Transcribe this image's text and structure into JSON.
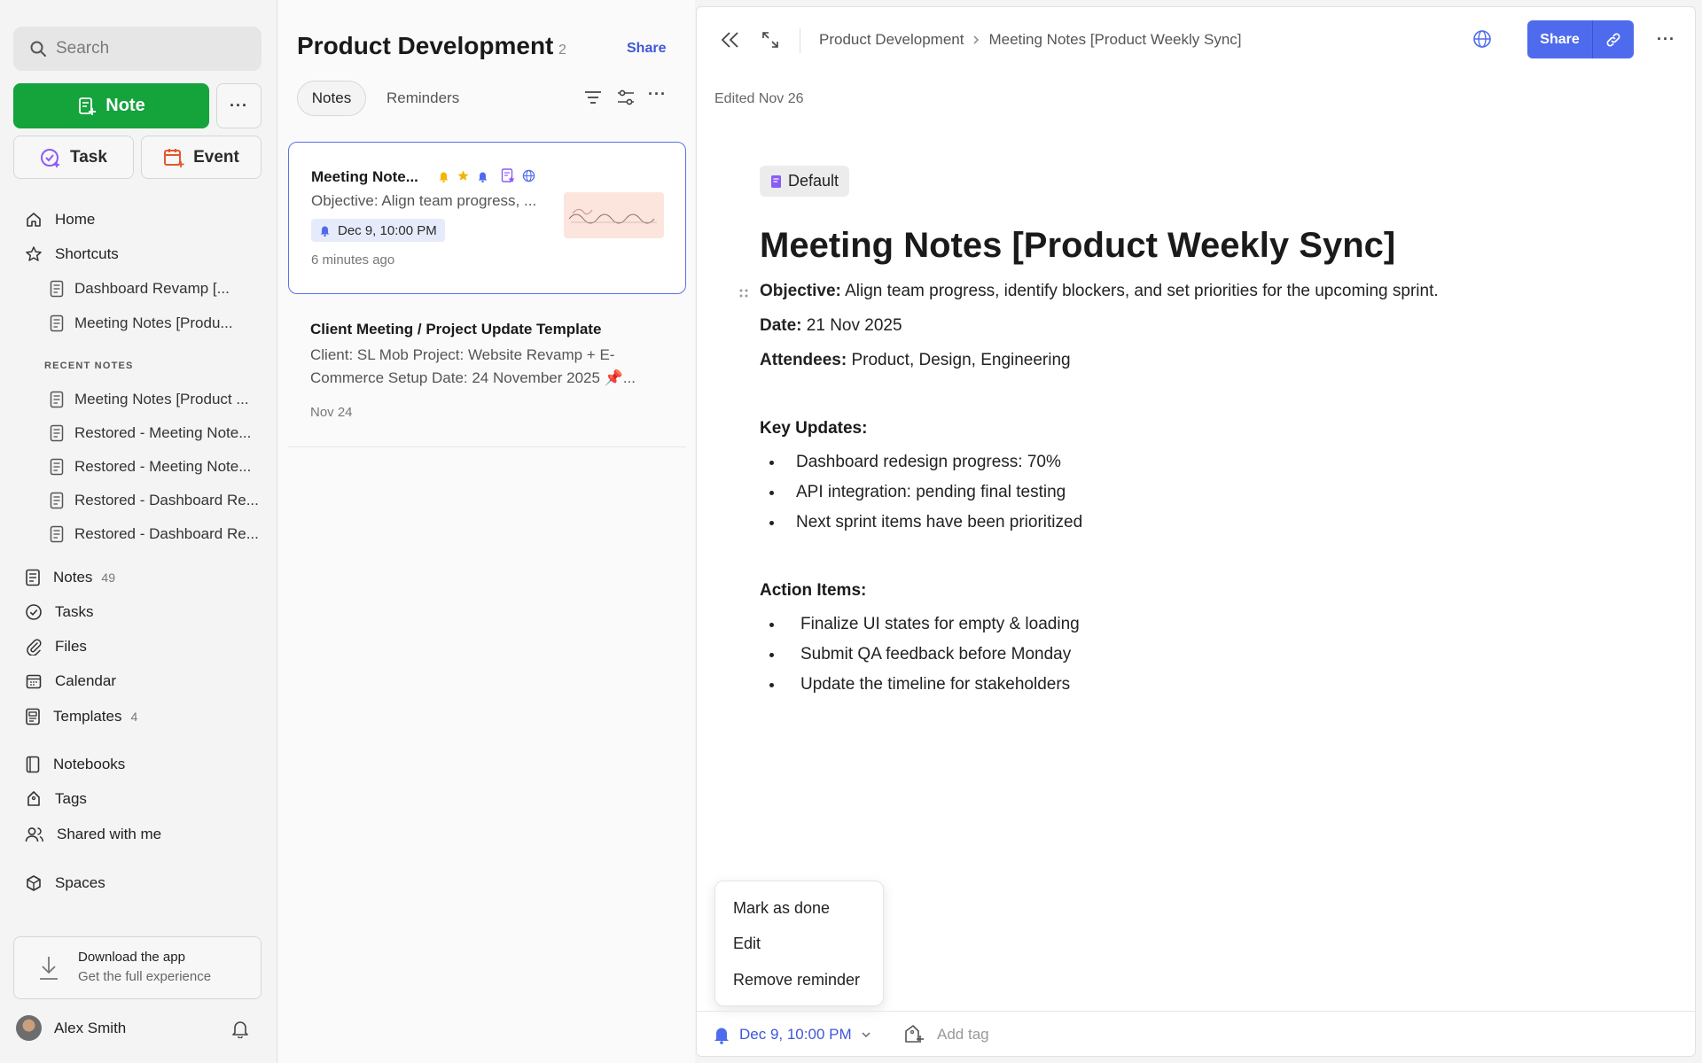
{
  "sidebar": {
    "search_placeholder": "Search",
    "new_note_label": "Note",
    "more_label": "···",
    "task_label": "Task",
    "event_label": "Event",
    "nav": {
      "home": "Home",
      "shortcuts": "Shortcuts",
      "notes": "Notes",
      "notes_count": "49",
      "tasks": "Tasks",
      "files": "Files",
      "calendar": "Calendar",
      "templates": "Templates",
      "templates_count": "4",
      "notebooks": "Notebooks",
      "tags": "Tags",
      "shared": "Shared with me",
      "spaces": "Spaces"
    },
    "shortcuts": [
      "Dashboard Revamp [...",
      "Meeting Notes [Produ..."
    ],
    "recent_label": "RECENT NOTES",
    "recent": [
      "Meeting Notes [Product ...",
      "Restored - Meeting Note...",
      "Restored - Meeting Note...",
      "Restored - Dashboard Re...",
      "Restored - Dashboard Re..."
    ],
    "download_title": "Download the app",
    "download_sub": "Get the full experience",
    "user_name": "Alex Smith"
  },
  "list": {
    "title": "Product Development",
    "count": "2",
    "share_label": "Share",
    "tabs": [
      "Notes",
      "Reminders"
    ],
    "cards": [
      {
        "title": "Meeting Note...",
        "excerpt": "Objective: Align team progress, ...",
        "reminder": "Dec 9, 10:00 PM",
        "time": "6 minutes ago"
      },
      {
        "title": "Client Meeting / Project Update Template",
        "excerpt": "Client: SL Mob Project: Website Revamp + E-Commerce Setup Date: 24 November 2025 📌...",
        "date": "Nov 24"
      }
    ]
  },
  "editor": {
    "breadcrumb": [
      "Product Development",
      "Meeting Notes [Product Weekly Sync]"
    ],
    "share_label": "Share",
    "edited": "Edited Nov 26",
    "tag": "Default",
    "title": "Meeting Notes [Product Weekly Sync]",
    "objective_label": "Objective:",
    "objective_text": " Align team progress, identify blockers, and set priorities for the upcoming sprint.",
    "date_label": "Date:",
    "date_text": " 21 Nov 2025",
    "attendees_label": "Attendees:",
    "attendees_text": " Product, Design, Engineering",
    "key_updates_heading": "Key Updates:",
    "key_updates": [
      "Dashboard redesign progress: 70%",
      "API integration: pending final testing",
      "Next sprint items have been prioritized"
    ],
    "action_items_heading": "Action Items:",
    "action_items": [
      "Finalize UI states for empty & loading",
      "Submit QA feedback before Monday",
      "Update the timeline for stakeholders"
    ],
    "reminder_menu": [
      "Mark as done",
      "Edit",
      "Remove reminder"
    ],
    "reminder": "Dec 9, 10:00 PM",
    "add_tag": "Add tag"
  },
  "colors": {
    "accent": "#4f6bed",
    "note_button": "#15a33c",
    "link_blue": "#3f57d6"
  }
}
